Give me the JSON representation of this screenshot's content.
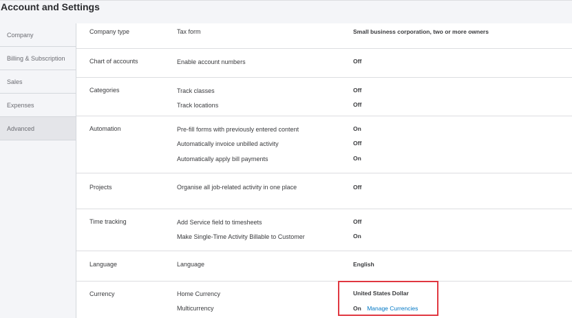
{
  "page": {
    "title": "Account and Settings"
  },
  "sidebar": {
    "items": [
      {
        "label": "Company"
      },
      {
        "label": "Billing & Subscription"
      },
      {
        "label": "Sales"
      },
      {
        "label": "Expenses"
      },
      {
        "label": "Advanced",
        "active": true
      }
    ]
  },
  "sections": {
    "company_type": {
      "title": "Company type",
      "rows": [
        {
          "label": "Tax form",
          "value": "Small business corporation, two or more owners"
        }
      ]
    },
    "chart_of_accounts": {
      "title": "Chart of accounts",
      "rows": [
        {
          "label": "Enable account numbers",
          "value": "Off"
        }
      ]
    },
    "categories": {
      "title": "Categories",
      "rows": [
        {
          "label": "Track classes",
          "value": "Off"
        },
        {
          "label": "Track locations",
          "value": "Off"
        }
      ]
    },
    "automation": {
      "title": "Automation",
      "rows": [
        {
          "label": "Pre-fill forms with previously entered content",
          "value": "On"
        },
        {
          "label": "Automatically invoice unbilled activity",
          "value": "Off"
        },
        {
          "label": "Automatically apply bill payments",
          "value": "On"
        }
      ]
    },
    "projects": {
      "title": "Projects",
      "rows": [
        {
          "label": "Organise all job-related activity in one place",
          "value": "Off"
        }
      ]
    },
    "time_tracking": {
      "title": "Time tracking",
      "rows": [
        {
          "label": "Add Service field to timesheets",
          "value": "Off"
        },
        {
          "label": "Make Single-Time Activity Billable to Customer",
          "value": "On"
        }
      ]
    },
    "language": {
      "title": "Language",
      "rows": [
        {
          "label": "Language",
          "value": "English"
        }
      ]
    },
    "currency": {
      "title": "Currency",
      "rows": [
        {
          "label": "Home Currency",
          "value": "United States Dollar"
        },
        {
          "label": "Multicurrency",
          "value": "On",
          "link": "Manage Currencies"
        }
      ]
    }
  },
  "colors": {
    "accent_link": "#0077c5",
    "highlight_border": "#e0363f"
  }
}
